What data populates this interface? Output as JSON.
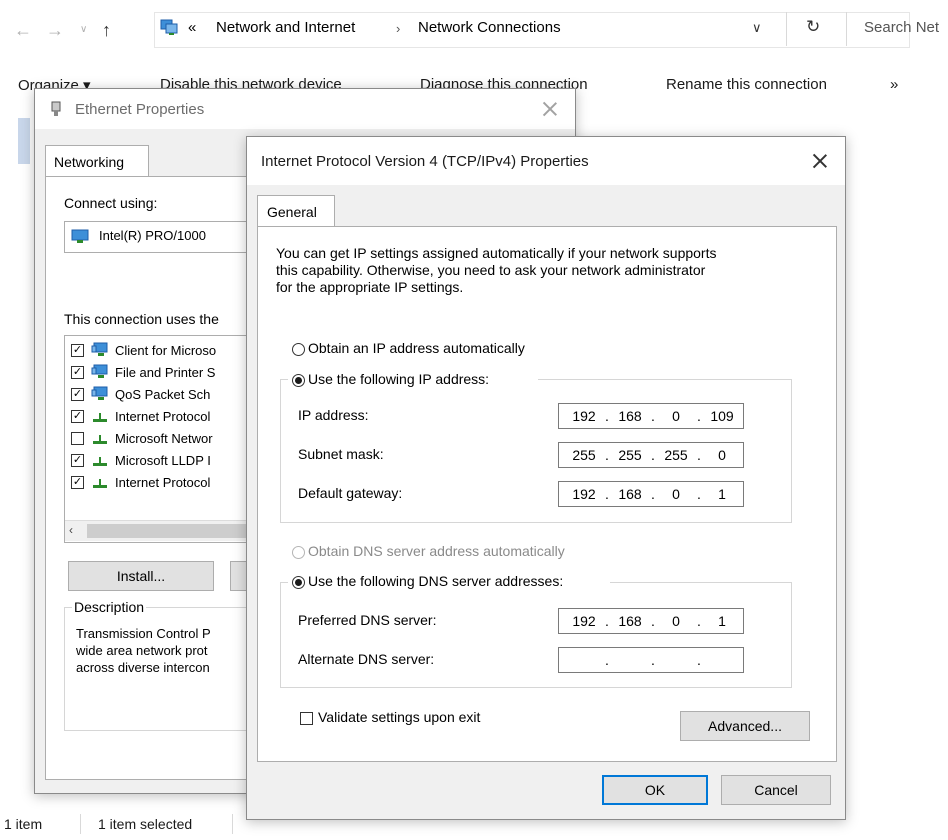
{
  "explorer": {
    "breadcrumb": {
      "overflow": "«",
      "items": [
        "Network and Internet",
        "Network Connections"
      ]
    },
    "search_placeholder": "Search Net",
    "command_bar": {
      "organize": "Organize ▾",
      "disable": "Disable this network device",
      "diagnose": "Diagnose this connection",
      "rename": "Rename this connection",
      "more": "»"
    },
    "status": {
      "items": "1 item",
      "selected": "1 item selected"
    }
  },
  "ethernet_dialog": {
    "title": "Ethernet Properties",
    "tab": "Networking",
    "connect_using_label": "Connect using:",
    "adapter_name": "Intel(R) PRO/1000",
    "uses_label": "This connection uses the",
    "items": [
      {
        "label": "Client for Microso",
        "checked": true,
        "icon": "network-client-icon"
      },
      {
        "label": "File and Printer S",
        "checked": true,
        "icon": "network-client-icon"
      },
      {
        "label": "QoS Packet Sch",
        "checked": true,
        "icon": "network-client-icon"
      },
      {
        "label": "Internet Protocol",
        "checked": true,
        "icon": "protocol-icon"
      },
      {
        "label": "Microsoft Networ",
        "checked": false,
        "icon": "protocol-icon"
      },
      {
        "label": "Microsoft LLDP I",
        "checked": true,
        "icon": "protocol-icon"
      },
      {
        "label": "Internet Protocol",
        "checked": true,
        "icon": "protocol-icon"
      }
    ],
    "install_button": "Install...",
    "description_label": "Description",
    "description_lines": [
      "Transmission Control P",
      "wide area network prot",
      "across diverse intercon"
    ]
  },
  "ipv4_dialog": {
    "title": "Internet Protocol Version 4 (TCP/IPv4) Properties",
    "tab": "General",
    "intro_lines": [
      "You can get IP settings assigned automatically if your network supports",
      "this capability. Otherwise, you need to ask your network administrator",
      "for the appropriate IP settings."
    ],
    "obtain_ip_auto": "Obtain an IP address automatically",
    "use_following_ip": "Use the following IP address:",
    "ip_label": "IP address:",
    "ip": [
      "192",
      "168",
      "0",
      "109"
    ],
    "subnet_label": "Subnet mask:",
    "subnet": [
      "255",
      "255",
      "255",
      "0"
    ],
    "gateway_label": "Default gateway:",
    "gateway": [
      "192",
      "168",
      "0",
      "1"
    ],
    "obtain_dns_auto": "Obtain DNS server address automatically",
    "use_following_dns": "Use the following DNS server addresses:",
    "preferred_dns_label": "Preferred DNS server:",
    "preferred_dns": [
      "192",
      "168",
      "0",
      "1"
    ],
    "alternate_dns_label": "Alternate DNS server:",
    "alternate_dns": [
      "",
      "",
      "",
      ""
    ],
    "validate_label": "Validate settings upon exit",
    "advanced_button": "Advanced...",
    "ok_button": "OK",
    "cancel_button": "Cancel"
  },
  "colors": {
    "accent": "#0078d7",
    "dialog_bg": "#f0f0f0",
    "disabled_text": "#8a8a8a"
  }
}
